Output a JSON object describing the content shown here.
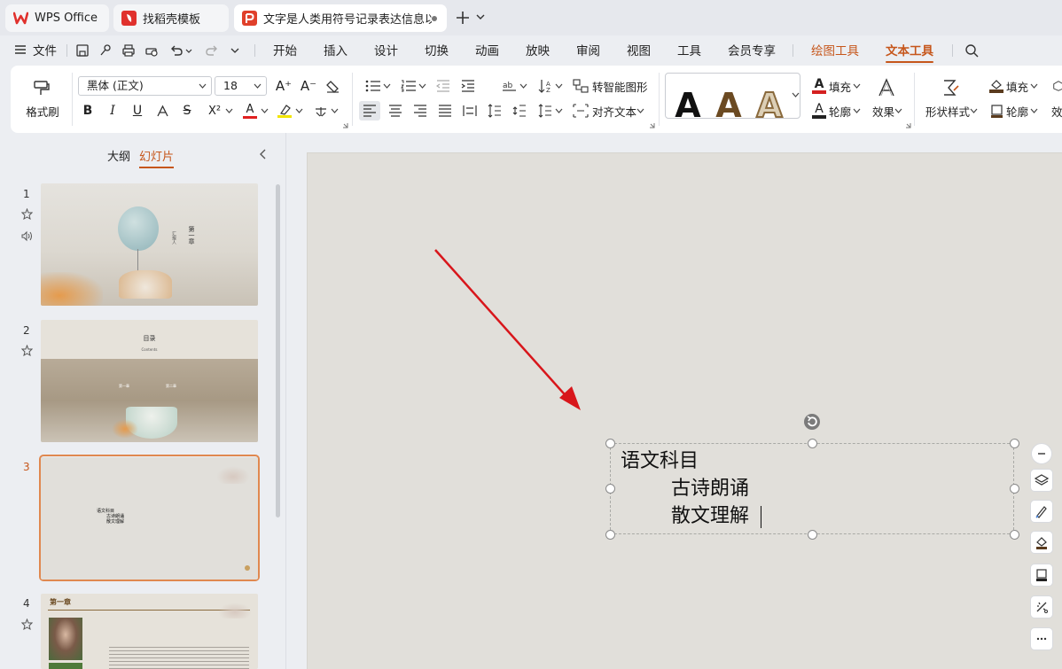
{
  "tabs": [
    {
      "label": "WPS Office"
    },
    {
      "label": "找稻壳模板"
    },
    {
      "label": "文字是人类用符号记录表达信息以"
    }
  ],
  "menu": {
    "file": "文件",
    "items": [
      "开始",
      "插入",
      "设计",
      "切换",
      "动画",
      "放映",
      "审阅",
      "视图",
      "工具",
      "会员专享"
    ],
    "drawing_tools": "绘图工具",
    "text_tools": "文本工具"
  },
  "ribbon": {
    "format_painter": "格式刷",
    "font_name": "黑体 (正文)",
    "font_size": "18",
    "smart_graphic": "转智能图形",
    "align_text": "对齐文本",
    "fill": "填充",
    "outline": "轮廓",
    "effects": "效果",
    "shape_style": "形状样式",
    "fill2": "填充",
    "outline2": "轮廓",
    "effects2": "效",
    "bold": "B",
    "italic": "I",
    "underline": "U",
    "strike": "S",
    "superscript": "X²",
    "wordart_letter": "A",
    "grow": "A⁺",
    "shrink": "A⁻",
    "font_color_letter": "A"
  },
  "leftpanel": {
    "outline_tab": "大纲",
    "slides_tab": "幻灯片",
    "slides": [
      {
        "num": "1",
        "title": "第一章",
        "subtitle": "汇报人"
      },
      {
        "num": "2",
        "title": "目录",
        "subtitle": "Contents",
        "items": [
          "第一章",
          "第二章"
        ]
      },
      {
        "num": "3",
        "lines": [
          "语文科目",
          "古诗朗诵",
          "散文理解"
        ]
      },
      {
        "num": "4",
        "title": "第一章"
      }
    ]
  },
  "slide": {
    "lines": [
      "语文科目",
      "古诗朗诵",
      "散文理解"
    ]
  },
  "colors": {
    "accent": "#c6561b",
    "arrow": "#d8161b",
    "slide_bg": "#e1dfda",
    "wps_red": "#e0312d"
  }
}
